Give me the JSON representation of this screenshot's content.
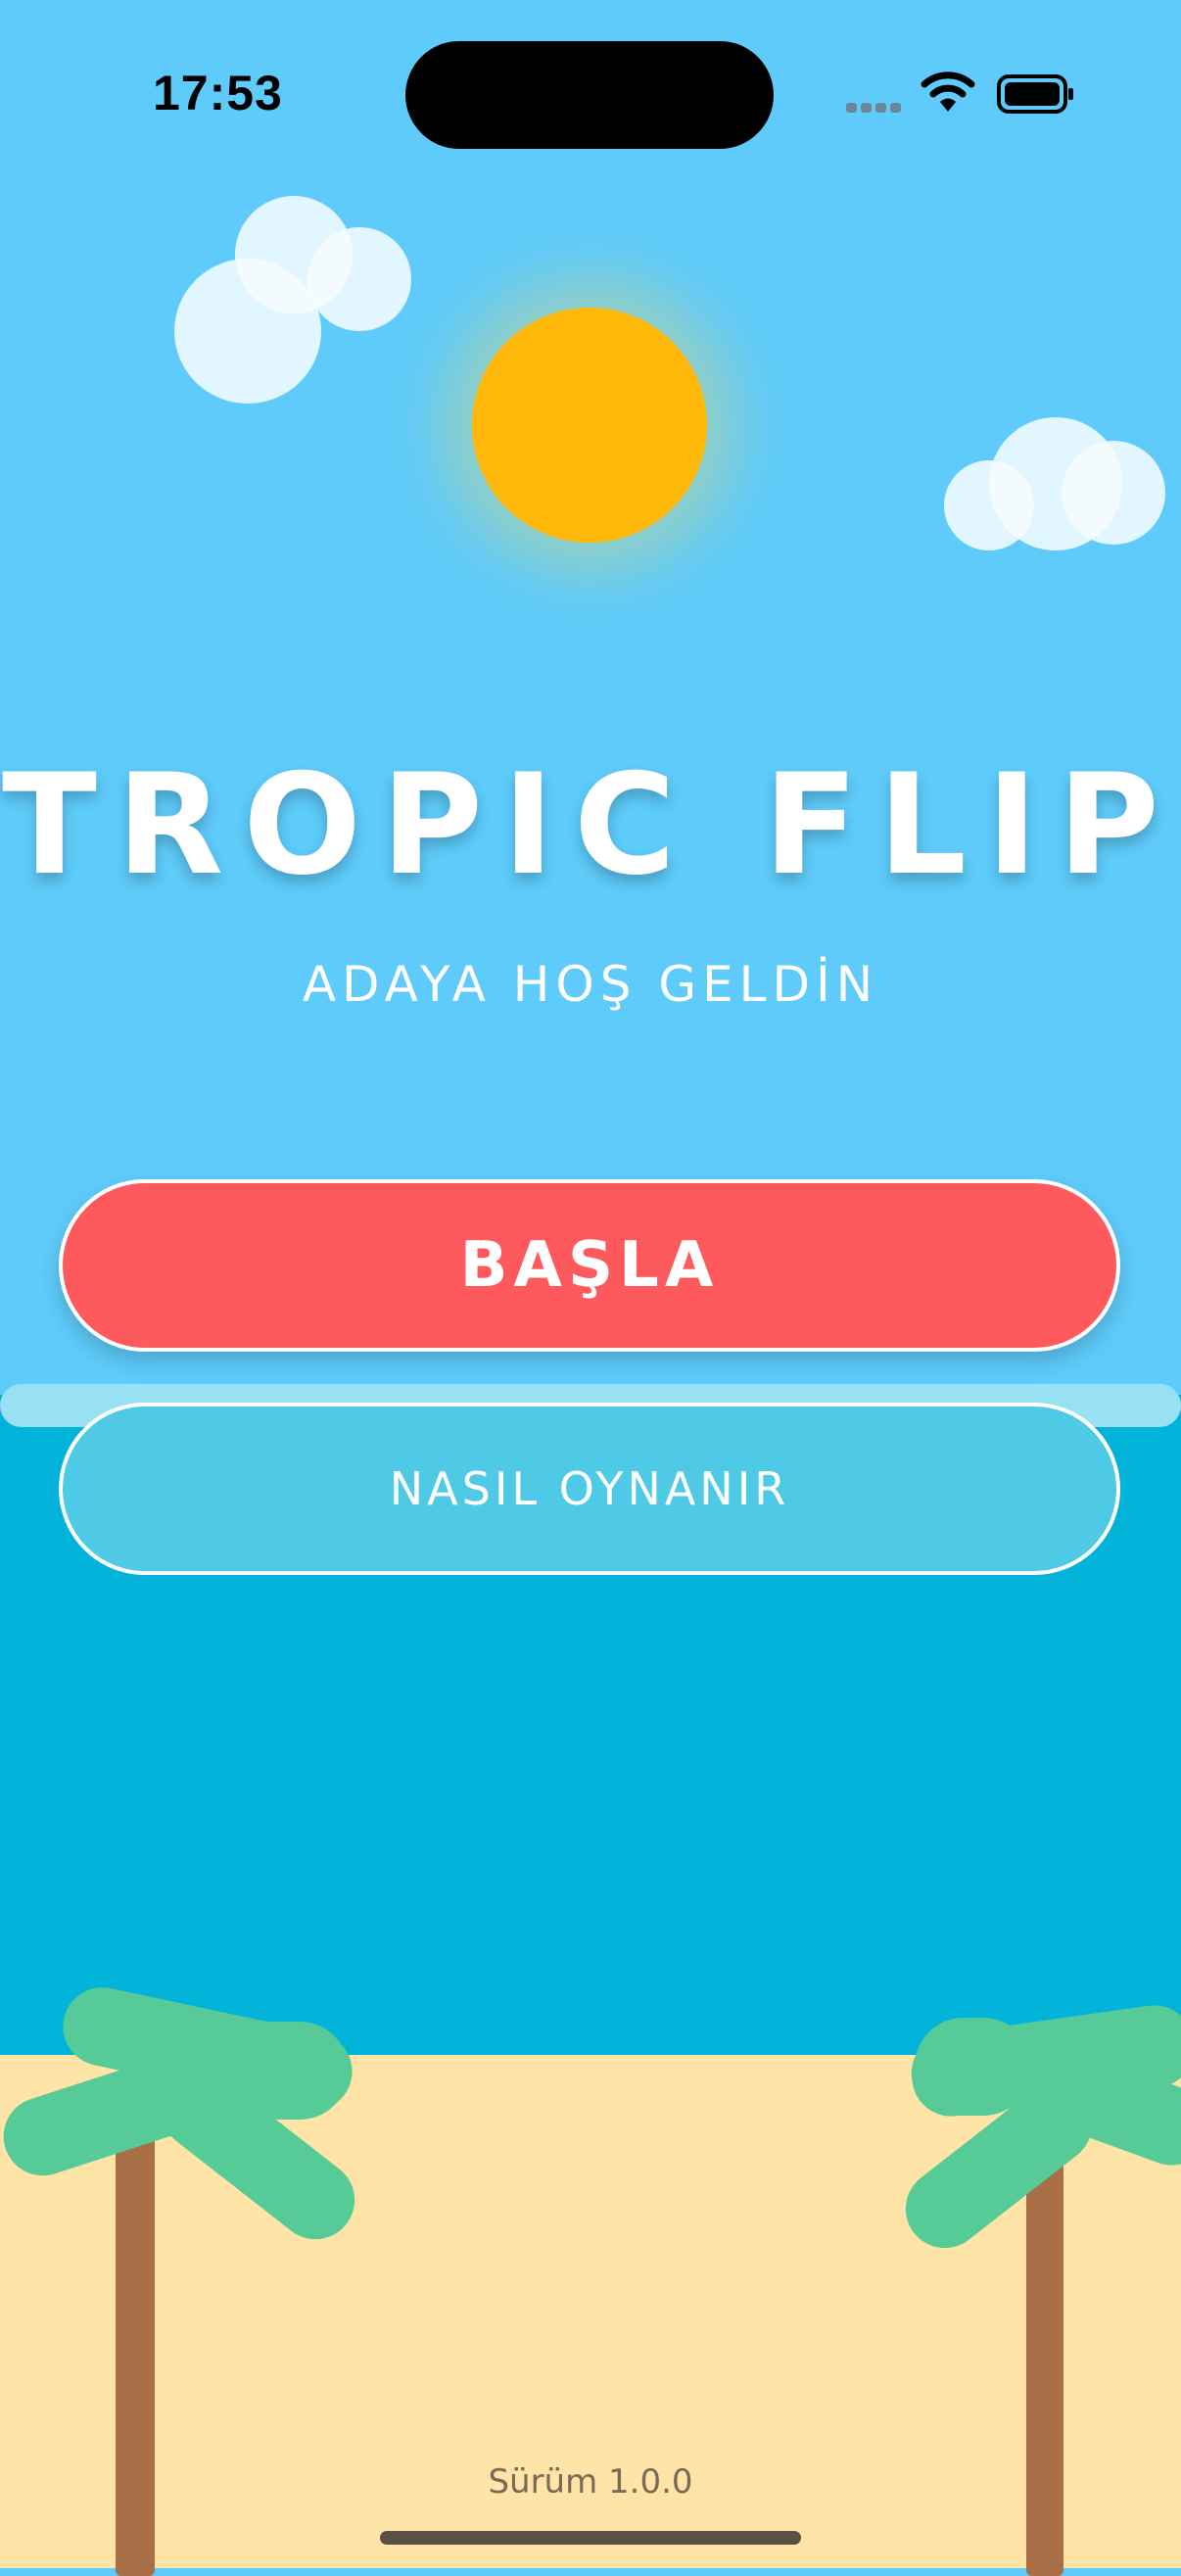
{
  "status_bar": {
    "time": "17:53",
    "icons": [
      "cellular-icon",
      "wifi-icon",
      "battery-icon"
    ]
  },
  "game": {
    "title": "TROPIC FLIP",
    "subtitle": "ADAYA HOŞ GELDİN"
  },
  "buttons": {
    "start_label": "BAŞLA",
    "how_to_play_label": "NASIL OYNANIR"
  },
  "footer": {
    "version": "Sürüm 1.0.0"
  },
  "colors": {
    "sky": "#5ecbfa",
    "sea": "#02b4da",
    "sand": "#fee4a6",
    "sun": "#ffb80a",
    "start_button": "#fe5a5e",
    "how_to_play_button": "#4ecae6",
    "palm_leaf": "#57cb97",
    "palm_trunk": "#a86e45"
  }
}
